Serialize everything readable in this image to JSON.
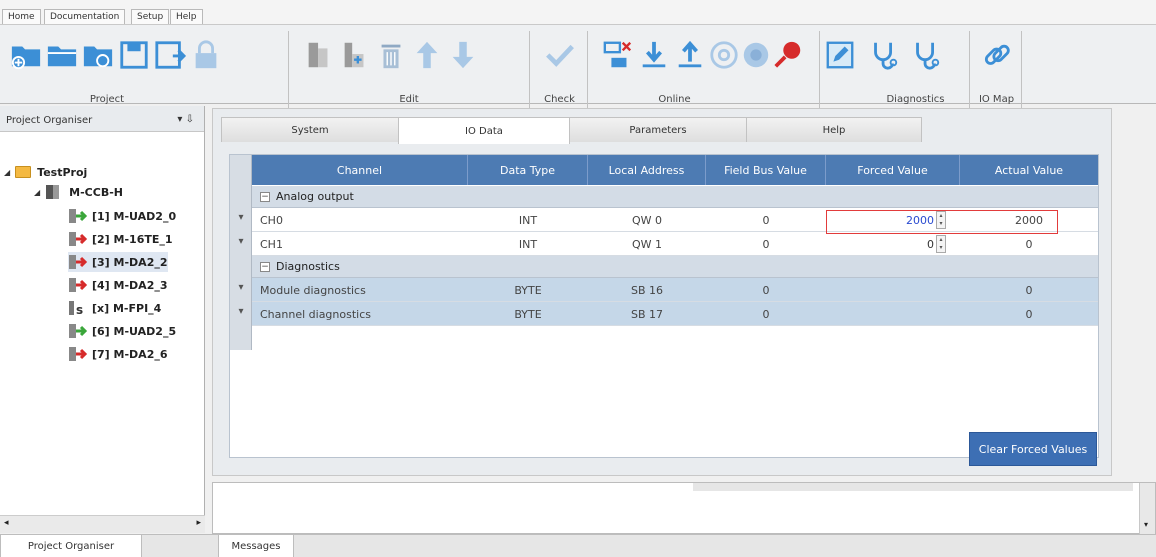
{
  "menu": {
    "tabs": [
      "Home",
      "Documentation",
      "Setup",
      "Help"
    ]
  },
  "ribbon": {
    "groups": {
      "project": "Project",
      "edit": "Edit",
      "check": "Check",
      "online": "Online",
      "diagnostics": "Diagnostics",
      "iomap": "IO Map"
    }
  },
  "organiser": {
    "title": "Project Organiser",
    "pin": "▾ ⇩",
    "project": "TestProj",
    "controller": "M-CCB-H",
    "modules": [
      {
        "label": "[1] M-UAD2_0",
        "icon": "module-green-arrow-icon",
        "color": "#3aa63a"
      },
      {
        "label": "[2] M-16TE_1",
        "icon": "module-red-arrow-icon",
        "color": "#d62b2b"
      },
      {
        "label": "[3] M-DA2_2",
        "icon": "module-red-arrow-icon",
        "color": "#d62b2b",
        "selected": true
      },
      {
        "label": "[4] M-DA2_3",
        "icon": "module-red-arrow-icon",
        "color": "#d62b2b"
      },
      {
        "label": "[x] M-FPI_4",
        "icon": "module-s-icon",
        "color": "#333333"
      },
      {
        "label": "[6] M-UAD2_5",
        "icon": "module-green-arrow-icon",
        "color": "#3aa63a"
      },
      {
        "label": "[7] M-DA2_6",
        "icon": "module-red-arrow-icon",
        "color": "#d62b2b"
      }
    ]
  },
  "tabs": [
    "System",
    "IO Data",
    "Parameters",
    "Help"
  ],
  "grid": {
    "columns": [
      "Channel",
      "Data Type",
      "Local Address",
      "Field Bus Value",
      "Forced Value",
      "Actual Value"
    ],
    "groups": [
      {
        "name": "Analog output",
        "rows": [
          {
            "channel": "CH0",
            "type": "INT",
            "address": "QW 0",
            "fieldbus": "0",
            "forced": "2000",
            "actual": "2000"
          },
          {
            "channel": "CH1",
            "type": "INT",
            "address": "QW 1",
            "fieldbus": "0",
            "forced": "0",
            "actual": "0"
          }
        ]
      },
      {
        "name": "Diagnostics",
        "rows": [
          {
            "channel": "Module diagnostics",
            "type": "BYTE",
            "address": "SB 16",
            "fieldbus": "0",
            "forced": "",
            "actual": "0"
          },
          {
            "channel": "Channel diagnostics",
            "type": "BYTE",
            "address": "SB 17",
            "fieldbus": "0",
            "forced": "",
            "actual": "0"
          }
        ]
      }
    ],
    "clear_button": "Clear Forced Values"
  },
  "bottom_tabs": {
    "left": "Project Organiser",
    "right": "Messages"
  },
  "colors": {
    "header_blue": "#4d7bb3",
    "accent_blue": "#3d6fb4",
    "highlight_red": "#e23b3b"
  }
}
